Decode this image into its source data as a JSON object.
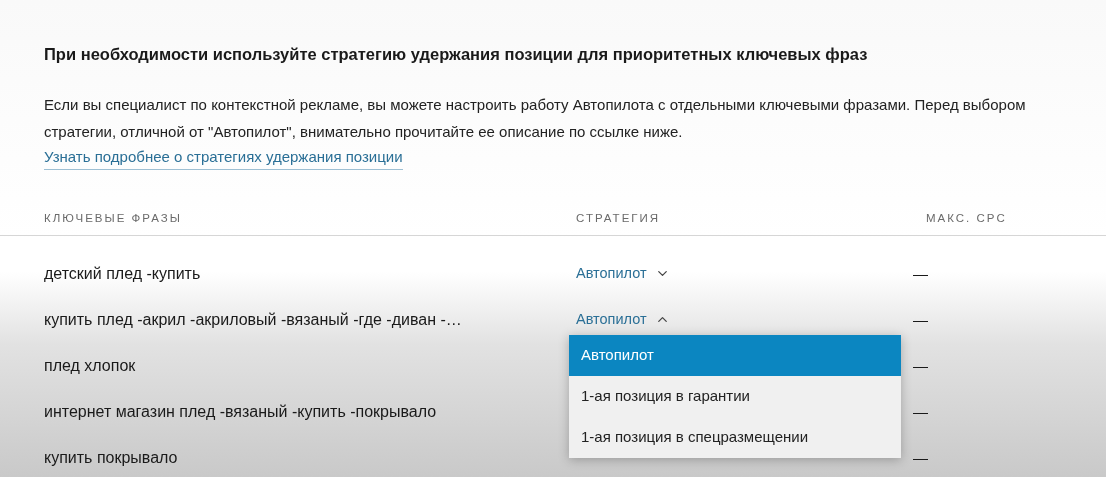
{
  "title": "При необходимости используйте стратегию удержания позиции для приоритетных ключевых фраз",
  "description": "Если вы специалист по контекстной рекламе, вы можете настроить работу Автопилота с отдельными ключевыми фразами. Перед выбором стратегии, отличной от \"Автопилот\", внимательно прочитайте ее описание по ссылке ниже.",
  "link": "Узнать подробнее о стратегиях удержания позиции",
  "table": {
    "columns": [
      "КЛЮЧЕВЫЕ ФРАЗЫ",
      "СТРАТЕГИЯ",
      "МАКС. CPC"
    ],
    "rows": [
      {
        "phrase": "детский плед -купить",
        "strategy": "Автопилот",
        "expanded": false,
        "cpc": "—"
      },
      {
        "phrase": "купить плед -акрил -акриловый -вязаный -где -диван -…",
        "strategy": "Автопилот",
        "expanded": true,
        "cpc": "—"
      },
      {
        "phrase": "плед хлопок",
        "cpc": "—"
      },
      {
        "phrase": "интернет магазин плед -вязаный -купить -покрывало",
        "cpc": "—"
      },
      {
        "phrase": "купить покрывало",
        "cpc": "—"
      }
    ]
  },
  "dropdown": {
    "options": [
      {
        "label": "Автопилот",
        "selected": true
      },
      {
        "label": "1-ая позиция в гарантии",
        "selected": false
      },
      {
        "label": "1-ая позиция в спецразмещении",
        "selected": false
      }
    ]
  }
}
